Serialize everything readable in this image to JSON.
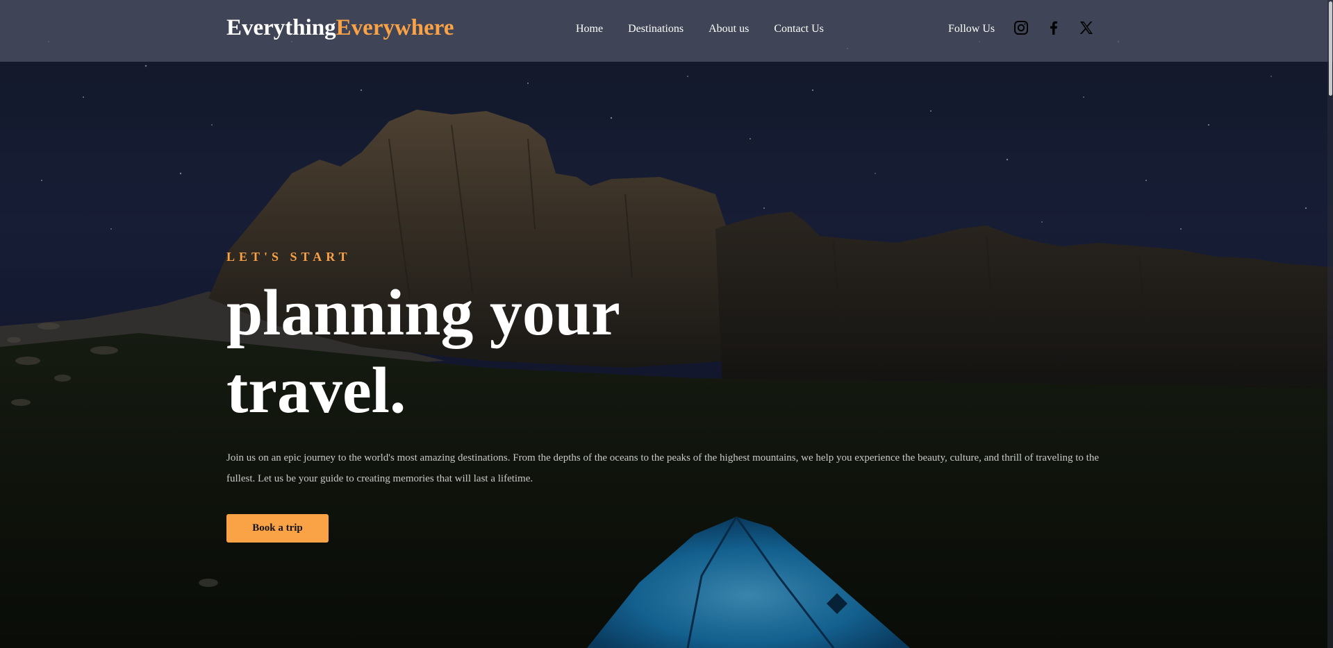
{
  "header": {
    "brand_part1": "Everything",
    "brand_part2": "Everywhere",
    "nav": [
      {
        "label": "Home"
      },
      {
        "label": "Destinations"
      },
      {
        "label": "About us"
      },
      {
        "label": "Contact Us"
      }
    ],
    "follow_label": "Follow Us",
    "social": [
      "instagram-icon",
      "facebook-icon",
      "x-twitter-icon"
    ]
  },
  "hero": {
    "eyebrow": "LET'S START",
    "headline_line1": "planning your",
    "headline_line2": "travel.",
    "description": "Join us on an epic journey to the world's most amazing destinations. From the depths of the oceans to the peaks of the highest mountains, we help you experience the beauty, culture, and thrill of traveling to the fullest. Let us be your guide to creating memories that will last a lifetime.",
    "cta_label": "Book a trip"
  },
  "colors": {
    "accent": "#f9a246",
    "nav_bg": "#505668",
    "text_light": "#ffffff",
    "body_text": "#c9c9c9",
    "tent": "#1f8fd0"
  }
}
